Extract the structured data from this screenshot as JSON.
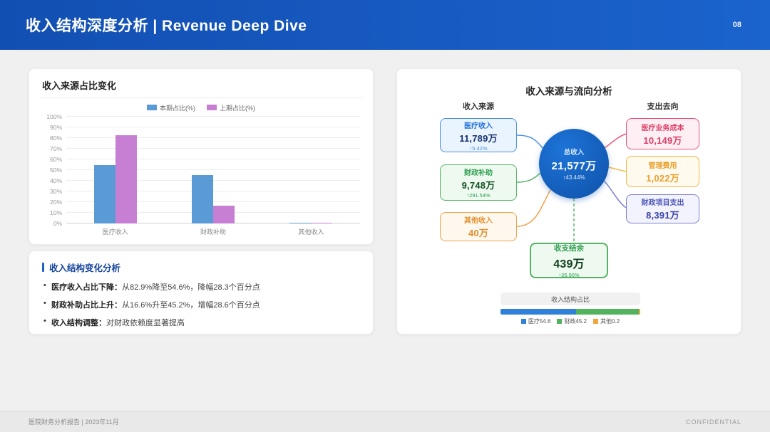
{
  "header": {
    "title": "收入结构深度分析 | Revenue Deep Dive",
    "page_number": "08"
  },
  "chart_data": [
    {
      "type": "bar",
      "title": "收入来源占比变化",
      "categories": [
        "医疗收入",
        "财政补助",
        "其他收入"
      ],
      "series": [
        {
          "name": "本期占比(%)",
          "color": "#5b9bd5",
          "values": [
            54.6,
            45.2,
            0.2
          ]
        },
        {
          "name": "上期占比(%)",
          "color": "#c77fd4",
          "values": [
            82.9,
            16.6,
            0.5
          ]
        }
      ],
      "ylim": [
        0,
        100
      ],
      "ytick_step": 10,
      "grid": true,
      "legend_position": "top"
    },
    {
      "type": "bar",
      "subtype": "stacked-horizontal",
      "title": "收入结构占比",
      "segments": [
        {
          "label": "医疗54.6",
          "value": 54.6,
          "color": "#2f80d9"
        },
        {
          "label": "财政45.2",
          "value": 45.2,
          "color": "#52b25e"
        },
        {
          "label": "其他0.2",
          "value": 0.2,
          "color": "#f2a33c"
        }
      ]
    }
  ],
  "analysis_card": {
    "title": "收入结构变化分析",
    "bullets": [
      {
        "lead": "医疗收入占比下降：",
        "text": "从82.9%降至54.6%，降幅28.3个百分点"
      },
      {
        "lead": "财政补助占比上升：",
        "text": "从16.6%升至45.2%，增幅28.6个百分点"
      },
      {
        "lead": "收入结构调整：",
        "text": "对财政依赖度显著提高"
      }
    ]
  },
  "flow_card": {
    "title": "收入来源与流向分析",
    "source_header": "收入来源",
    "expense_header": "支出去向",
    "sources": [
      {
        "label": "医疗收入",
        "value": "11,789万",
        "change": "↑5.42%"
      },
      {
        "label": "财政补助",
        "value": "9,748万",
        "change": "↑291.54%"
      },
      {
        "label": "其他收入",
        "value": "40万",
        "change": ""
      }
    ],
    "total": {
      "label": "总收入",
      "value": "21,577万",
      "change": "↑43.44%"
    },
    "expenses": [
      {
        "label": "医疗业务成本",
        "value": "10,149万"
      },
      {
        "label": "管理费用",
        "value": "1,022万"
      },
      {
        "label": "财政项目支出",
        "value": "8,391万"
      }
    ],
    "balance": {
      "label": "收支结余",
      "value": "439万",
      "change": "↑35.90%"
    }
  },
  "footer": {
    "left": "医院财务分析报告 | 2023年11月",
    "right": "CONFIDENTIAL"
  }
}
